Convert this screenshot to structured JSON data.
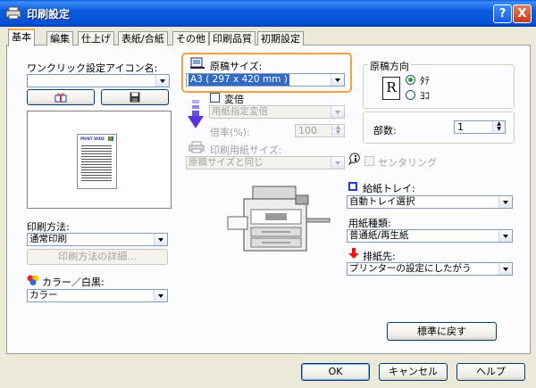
{
  "window": {
    "title": "印刷設定",
    "help": "?",
    "close": "X"
  },
  "tabs": [
    "基本",
    "編集",
    "仕上げ",
    "表紙/合紙",
    "その他",
    "印刷品質",
    "初期設定"
  ],
  "one_click": {
    "label": "ワンクリック設定アイコン名:",
    "value": ""
  },
  "print_method": {
    "label": "印刷方法:",
    "value": "通常印刷",
    "details_button": "印刷方法の詳細..."
  },
  "color_mode": {
    "label": "カラー／白黒:",
    "value": "カラー"
  },
  "original_size": {
    "label": "原稿サイズ:",
    "value": "A3 ( 297 x 420 mm )"
  },
  "scale": {
    "checkbox_label": "変倍",
    "mode_value": "用紙指定変倍",
    "ratio_label": "倍率(%):",
    "ratio_value": "100"
  },
  "output_size": {
    "label": "印刷用紙サイズ:",
    "value": "原稿サイズと同じ"
  },
  "orientation": {
    "label": "原稿方向",
    "portrait": "ﾀﾃ",
    "landscape": "ﾖｺ",
    "icon_letter": "R"
  },
  "copies": {
    "label": "部数:",
    "value": "1"
  },
  "center": {
    "label": "センタリング"
  },
  "paper_source": {
    "label": "給紙トレイ:",
    "value": "自動トレイ選択"
  },
  "paper_type": {
    "label": "用紙種類:",
    "value": "普通紙/再生紙"
  },
  "output_dest": {
    "label": "排紙先:",
    "value": "プリンターの設定にしたがう"
  },
  "restore_button": "標準に戻す",
  "footer": {
    "ok": "OK",
    "cancel": "キャンセル",
    "help": "ヘルプ"
  },
  "preview_thumb_text": "PRINT WIDE"
}
